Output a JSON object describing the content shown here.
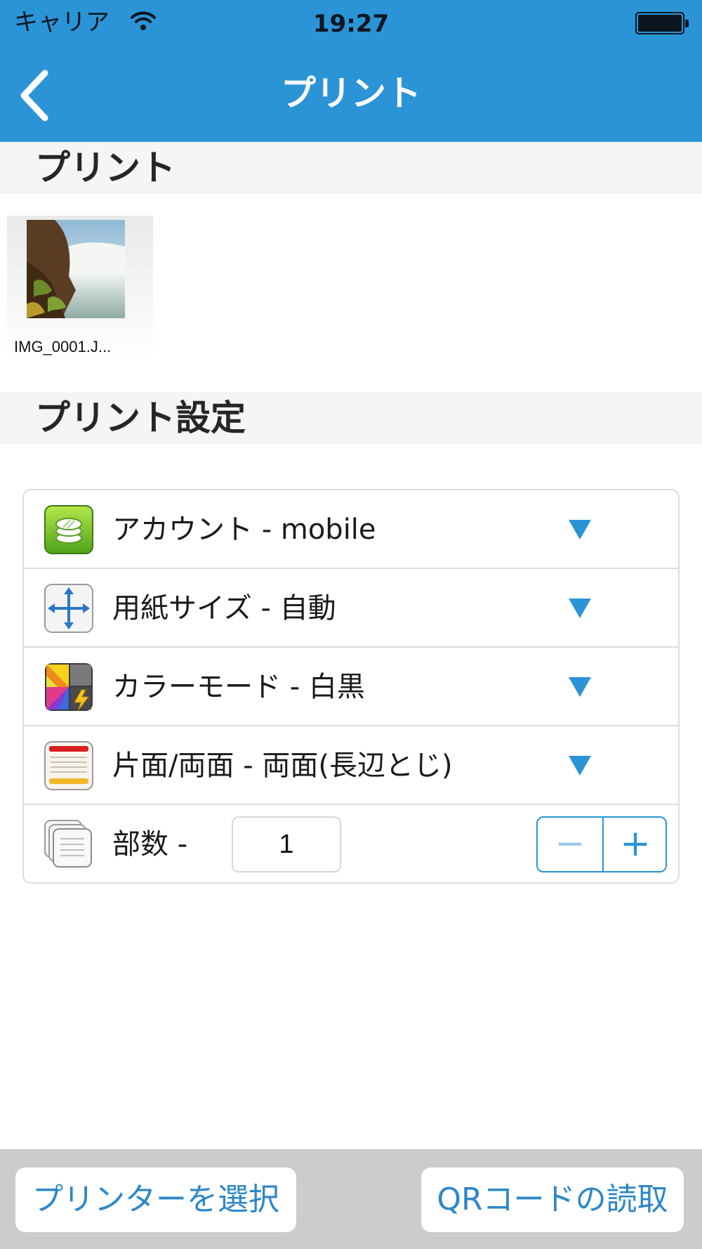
{
  "status_bar": {
    "carrier": "キャリア",
    "time": "19:27"
  },
  "nav": {
    "title": "プリント"
  },
  "sections": {
    "print": "プリント",
    "settings": "プリント設定"
  },
  "file": {
    "name": "IMG_0001.J..."
  },
  "settings": {
    "account": "アカウント - mobile",
    "paper_size": "用紙サイズ - 自動",
    "color_mode": "カラーモード - 白黒",
    "duplex": "片面/両面 - 両面(長辺とじ)",
    "copies_label": "部数 -",
    "copies_value": "1",
    "decrement": "−",
    "increment": "+"
  },
  "toolbar": {
    "select_printer": "プリンターを選択",
    "qr_read": "QRコードの読取"
  },
  "colors": {
    "accent": "#2b94d6",
    "bottom_bar": "#cccccc",
    "section_bg": "#f5f5f5"
  },
  "icons": [
    "wifi-icon",
    "battery-icon",
    "back-chevron-icon",
    "account-icon",
    "paper-size-icon",
    "color-mode-icon",
    "duplex-icon",
    "copies-icon",
    "dropdown-triangle-icon"
  ]
}
